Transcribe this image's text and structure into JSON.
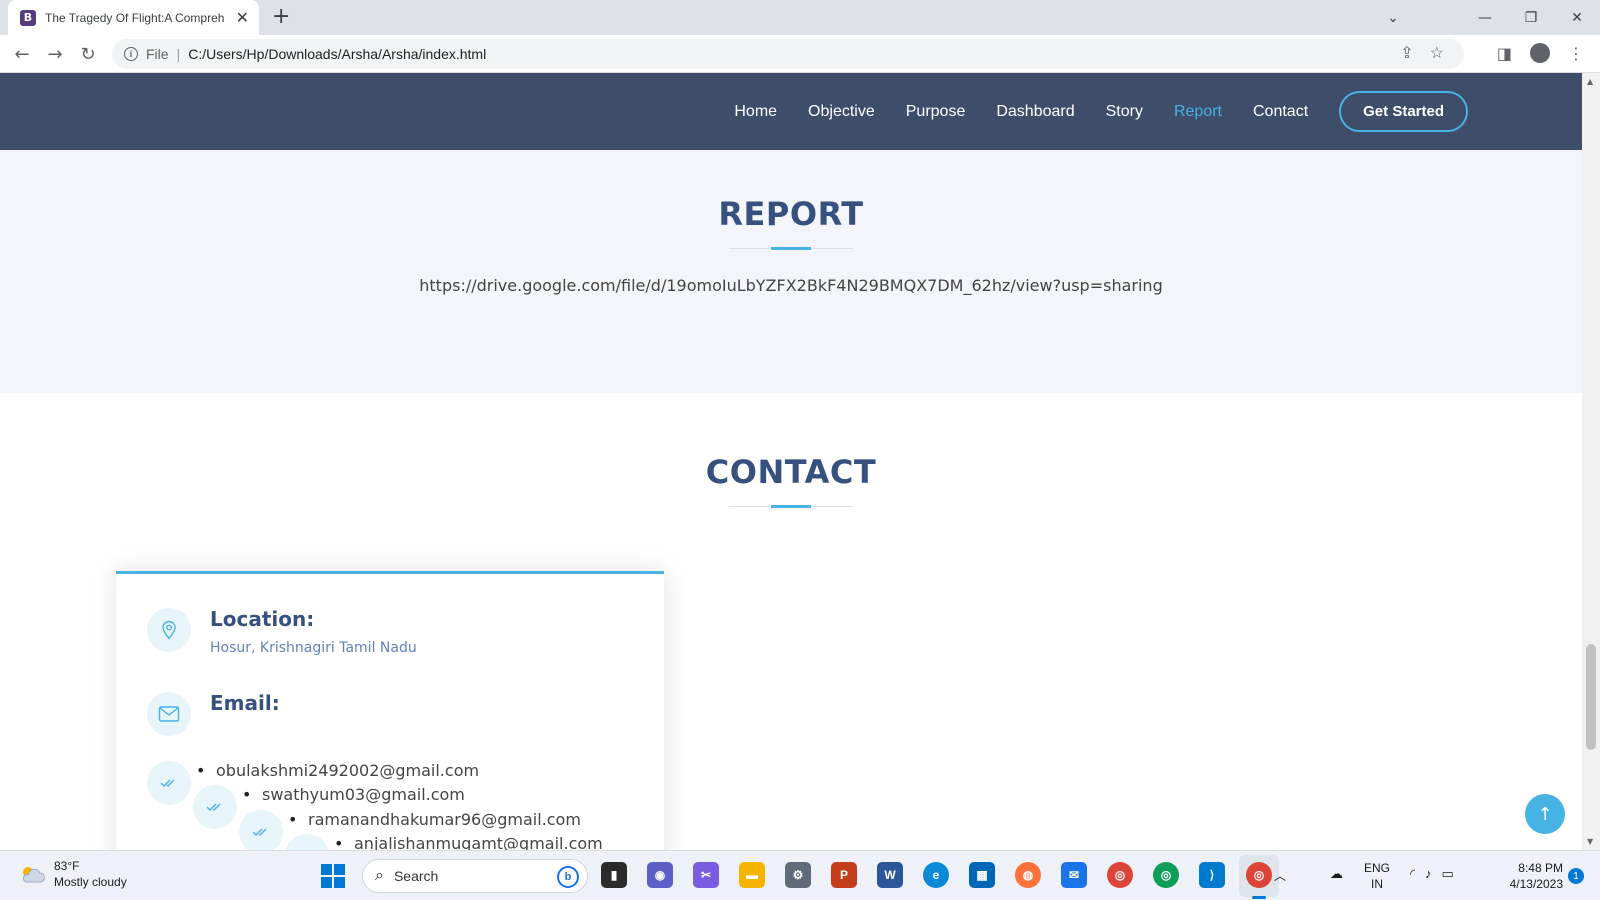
{
  "browser": {
    "tab_title": "The Tragedy Of Flight:A Compreh",
    "tab_favicon": "B",
    "omnibox_scheme": "File",
    "omnibox_url": "C:/Users/Hp/Downloads/Arsha/Arsha/index.html"
  },
  "nav": {
    "items": [
      {
        "label": "Home",
        "active": false
      },
      {
        "label": "Objective",
        "active": false
      },
      {
        "label": "Purpose",
        "active": false
      },
      {
        "label": "Dashboard",
        "active": false
      },
      {
        "label": "Story",
        "active": false
      },
      {
        "label": "Report",
        "active": true
      },
      {
        "label": "Contact",
        "active": false
      }
    ],
    "cta": "Get Started"
  },
  "report": {
    "title": "REPORT",
    "link": "https://drive.google.com/file/d/19omoIuLbYZFX2BkF4N29BMQX7DM_62hz/view?usp=sharing"
  },
  "contact": {
    "title": "CONTACT",
    "location_label": "Location:",
    "location_value": "Hosur, Krishnagiri Tamil Nadu",
    "email_label": "Email:",
    "emails": [
      "obulakshmi2492002@gmail.com",
      "swathyum03@gmail.com",
      "ramanandhakumar96@gmail.com",
      "anjalishanmugamt@gmail.com"
    ]
  },
  "taskbar": {
    "weather_temp": "83°F",
    "weather_desc": "Mostly cloudy",
    "search_placeholder": "Search",
    "lang_top": "ENG",
    "lang_bottom": "IN",
    "time": "8:48 PM",
    "date": "4/13/2023",
    "notification_count": "1"
  },
  "colors": {
    "header_bg": "#3d4d6a",
    "accent": "#47b2e4",
    "title": "#37517e",
    "section_bg": "#f3f5fa"
  }
}
